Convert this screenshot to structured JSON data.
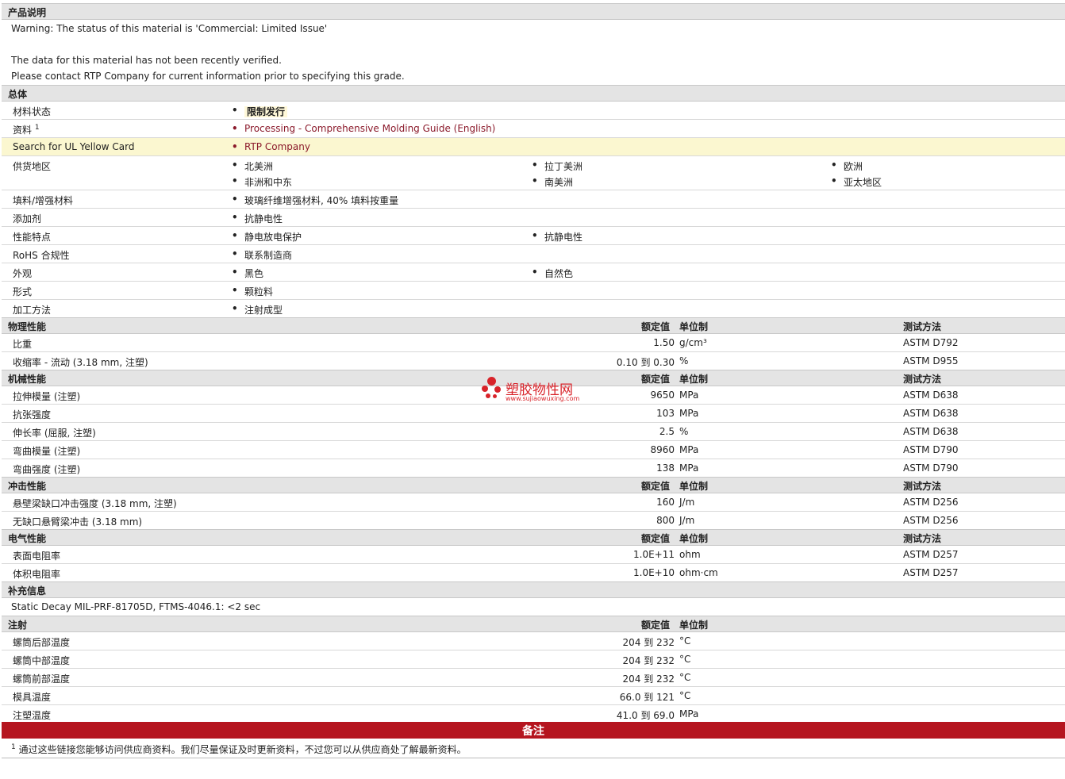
{
  "desc": {
    "title": "产品说明",
    "line1": "Warning: The status of this material is 'Commercial: Limited Issue'",
    "line2": "The data for this material has not been recently verified.",
    "line3": "Please contact RTP Company for current information prior to specifying this grade."
  },
  "general": {
    "title": "总体",
    "status_label": "材料状态",
    "status_value": "限制发行",
    "source_label": "资料",
    "source_sup": "1",
    "source_value": "Processing - Comprehensive Molding Guide (English)",
    "ul_label": "Search for UL Yellow Card",
    "ul_value": "RTP Company",
    "regions_label": "供货地区",
    "regions": [
      "北美洲",
      "拉丁美洲",
      "欧洲",
      "非洲和中东",
      "南美洲",
      "亚太地区"
    ],
    "filler_label": "填料/增强材料",
    "filler_value": "玻璃纤维增强材料, 40% 填料按重量",
    "additive_label": "添加剂",
    "additive_value": "抗静电性",
    "features_label": "性能特点",
    "features": [
      "静电放电保护",
      "抗静电性"
    ],
    "rohs_label": "RoHS 合规性",
    "rohs_value": "联系制造商",
    "appearance_label": "外观",
    "appearance": [
      "黑色",
      "自然色"
    ],
    "form_label": "形式",
    "form_value": "颗粒料",
    "process_label": "加工方法",
    "process_value": "注射成型"
  },
  "headers": {
    "nominal": "额定值",
    "unit": "单位制",
    "test": "测试方法"
  },
  "physical": {
    "title": "物理性能",
    "rows": [
      {
        "name": "比重",
        "value": "1.50",
        "unit": "g/cm³",
        "test": "ASTM D792"
      },
      {
        "name": "收缩率 - 流动 (3.18 mm, 注塑)",
        "value": "0.10 到  0.30",
        "unit": "%",
        "test": "ASTM D955"
      }
    ]
  },
  "mechanical": {
    "title": "机械性能",
    "rows": [
      {
        "name": "拉伸模量 (注塑)",
        "value": "9650",
        "unit": "MPa",
        "test": "ASTM D638"
      },
      {
        "name": "抗张强度",
        "value": "103",
        "unit": "MPa",
        "test": "ASTM D638"
      },
      {
        "name": "伸长率 (屈服, 注塑)",
        "value": "2.5",
        "unit": "%",
        "test": "ASTM D638"
      },
      {
        "name": "弯曲模量 (注塑)",
        "value": "8960",
        "unit": "MPa",
        "test": "ASTM D790"
      },
      {
        "name": "弯曲强度 (注塑)",
        "value": "138",
        "unit": "MPa",
        "test": "ASTM D790"
      }
    ]
  },
  "impact": {
    "title": "冲击性能",
    "rows": [
      {
        "name": "悬壁梁缺口冲击强度 (3.18 mm, 注塑)",
        "value": "160",
        "unit": "J/m",
        "test": "ASTM D256"
      },
      {
        "name": "无缺口悬臂梁冲击 (3.18 mm)",
        "value": "800",
        "unit": "J/m",
        "test": "ASTM D256"
      }
    ]
  },
  "electrical": {
    "title": "电气性能",
    "rows": [
      {
        "name": "表面电阻率",
        "value": "1.0E+11",
        "unit": "ohm",
        "test": "ASTM D257"
      },
      {
        "name": "体积电阻率",
        "value": "1.0E+10",
        "unit": "ohm·cm",
        "test": "ASTM D257"
      }
    ]
  },
  "supplement": {
    "title": "补充信息",
    "text": "Static Decay MIL-PRF-81705D, FTMS-4046.1: <2 sec"
  },
  "injection": {
    "title": "注射",
    "rows": [
      {
        "name": "螺筒后部温度",
        "value": "204 到  232",
        "unit": "°C"
      },
      {
        "name": "螺筒中部温度",
        "value": "204 到  232",
        "unit": "°C"
      },
      {
        "name": "螺筒前部温度",
        "value": "204 到  232",
        "unit": "°C"
      },
      {
        "name": "模具温度",
        "value": "66.0 到  121",
        "unit": "°C"
      },
      {
        "name": "注塑温度",
        "value": "41.0 到  69.0",
        "unit": "MPa"
      }
    ]
  },
  "notes": {
    "title": "备注",
    "sup": "1",
    "text": "通过这些链接您能够访问供应商资料。我们尽量保证及时更新资料，不过您可以从供应商处了解最新资料。"
  },
  "watermark": {
    "name": "塑胶物性网",
    "url": "www.sujiaowuxing.com"
  }
}
